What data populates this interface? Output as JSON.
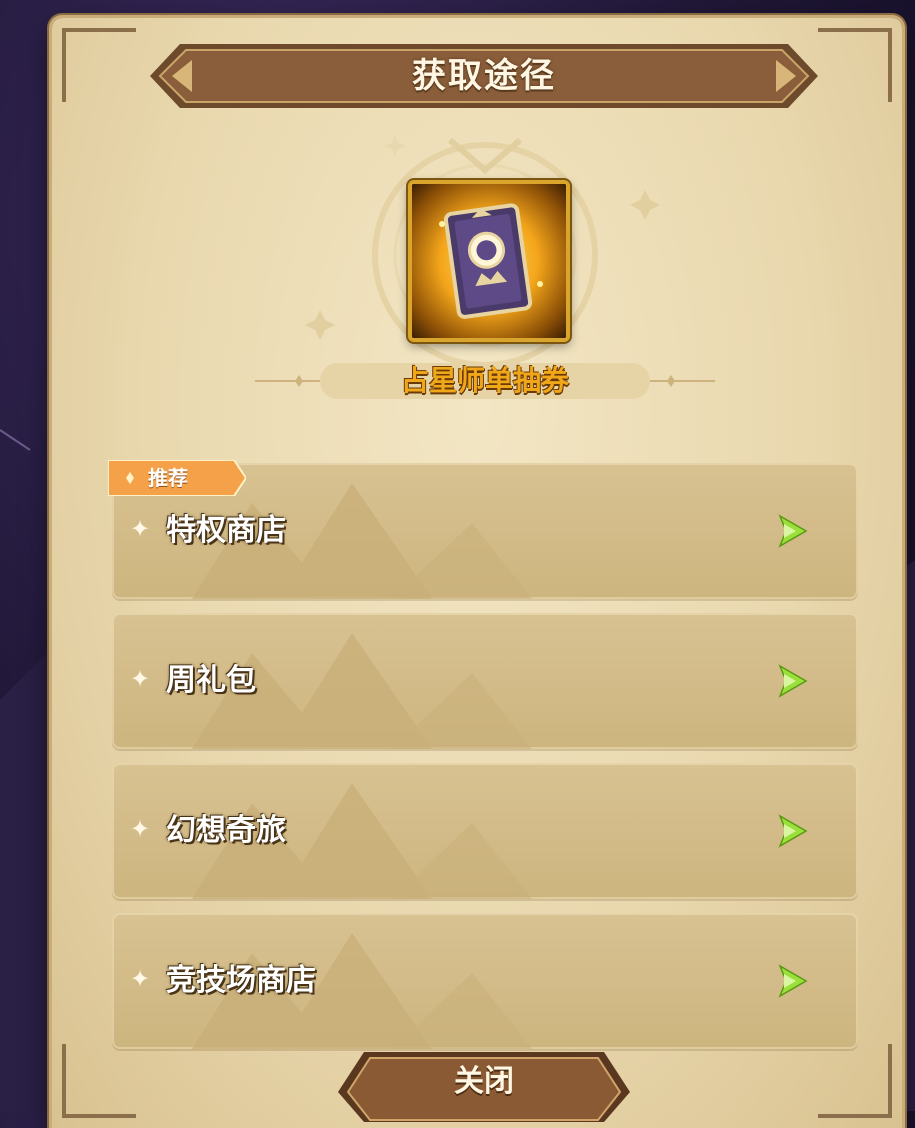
{
  "dialog": {
    "title": "获取途径"
  },
  "item": {
    "name": "占星师单抽券",
    "icon": "astrologer-ticket-icon"
  },
  "recommend_tag": "推荐",
  "sources": [
    {
      "label": "特权商店",
      "recommended": true
    },
    {
      "label": "周礼包",
      "recommended": false
    },
    {
      "label": "幻想奇旅",
      "recommended": false
    },
    {
      "label": "竞技场商店",
      "recommended": false
    }
  ],
  "close_button": {
    "label": "关闭"
  },
  "colors": {
    "parchment": "#e9d8ae",
    "banner_brown": "#8a5e3a",
    "item_name_orange": "#f0a818",
    "arrow_green": "#9be03a"
  }
}
